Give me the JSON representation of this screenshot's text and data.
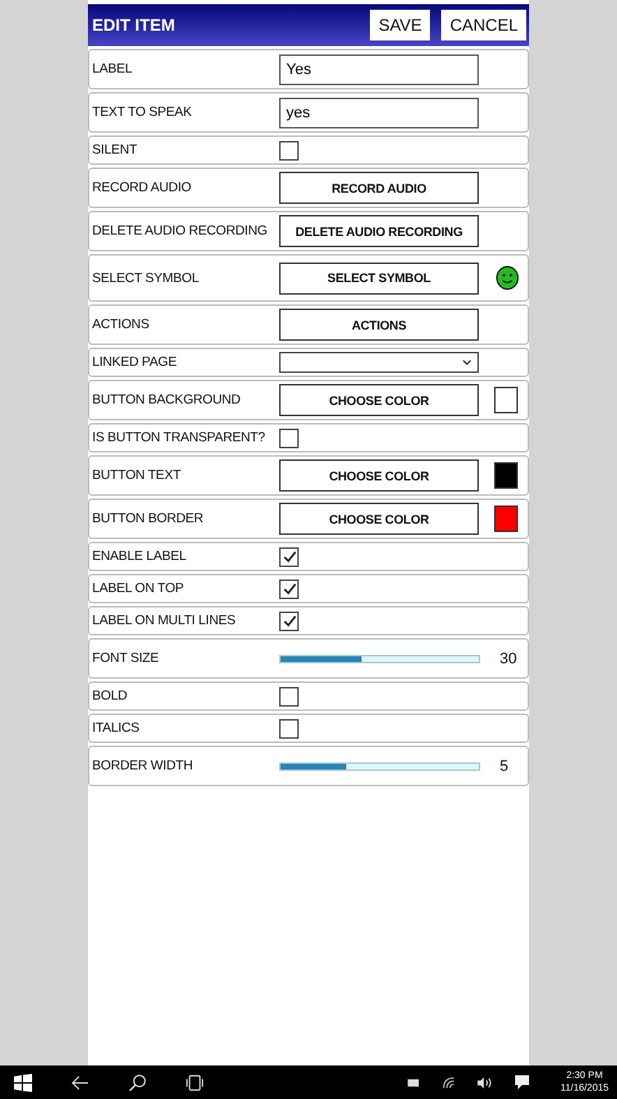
{
  "header": {
    "title": "EDIT ITEM",
    "buttons": [
      "SAVE",
      "CANCEL"
    ]
  },
  "rows": [
    {
      "kind": "text",
      "label": "LABEL",
      "value": "Yes"
    },
    {
      "kind": "text",
      "label": "TEXT TO SPEAK",
      "value": "yes"
    },
    {
      "kind": "checkbox",
      "label": "SILENT",
      "checked": false
    },
    {
      "kind": "button",
      "label": "RECORD AUDIO",
      "button": "RECORD AUDIO"
    },
    {
      "kind": "button",
      "label": "DELETE AUDIO RECORDING",
      "button": "DELETE AUDIO RECORDING"
    },
    {
      "kind": "symbol",
      "label": "SELECT SYMBOL",
      "button": "SELECT SYMBOL"
    },
    {
      "kind": "button",
      "label": "ACTIONS",
      "button": "ACTIONS"
    },
    {
      "kind": "select",
      "label": "LINKED PAGE"
    },
    {
      "kind": "color",
      "label": "BUTTON BACKGROUND",
      "button": "CHOOSE COLOR",
      "color": "#ffffff"
    },
    {
      "kind": "checkbox",
      "label": "IS BUTTON TRANSPARENT?",
      "checked": false
    },
    {
      "kind": "color",
      "label": "BUTTON TEXT",
      "button": "CHOOSE COLOR",
      "color": "#000000"
    },
    {
      "kind": "color",
      "label": "BUTTON BORDER",
      "button": "CHOOSE COLOR",
      "color": "#ff0000"
    },
    {
      "kind": "checkbox",
      "label": "ENABLE LABEL",
      "checked": true
    },
    {
      "kind": "checkbox",
      "label": "LABEL ON TOP",
      "checked": true
    },
    {
      "kind": "checkbox",
      "label": "LABEL ON MULTI LINES",
      "checked": true
    },
    {
      "kind": "slider",
      "label": "FONT SIZE",
      "level": 0.41,
      "reading": "30"
    },
    {
      "kind": "checkbox",
      "label": "BOLD",
      "checked": false
    },
    {
      "kind": "checkbox",
      "label": "ITALICS",
      "checked": false
    },
    {
      "kind": "slider",
      "label": "BORDER WIDTH",
      "level": 0.33,
      "reading": "5"
    }
  ],
  "taskbar": {
    "time": "2:30 PM",
    "date": "11/16/2015"
  }
}
